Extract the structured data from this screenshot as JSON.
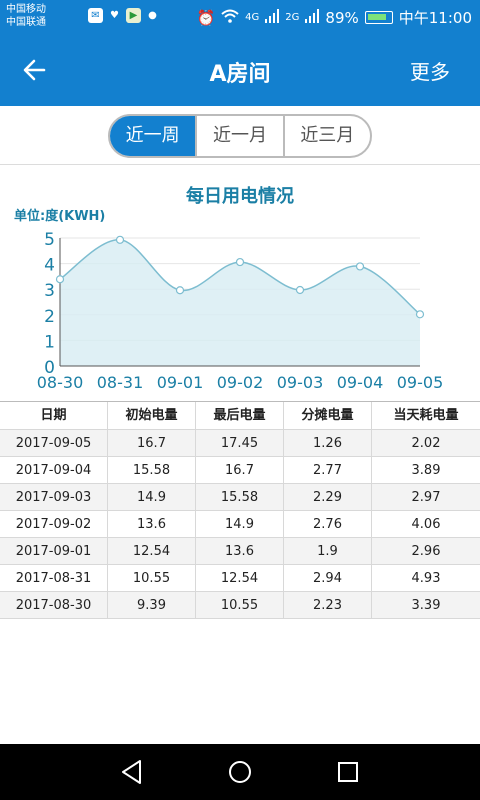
{
  "status_bar": {
    "carrier_1": "中国移动",
    "carrier_2": "中国联通",
    "net_4g": "4G",
    "net_2g": "2G",
    "battery": "89%",
    "time": "中午11:00"
  },
  "header": {
    "title": "A房间",
    "more_label": "更多"
  },
  "tabs": [
    {
      "label": "近一周",
      "active": true
    },
    {
      "label": "近一月",
      "active": false
    },
    {
      "label": "近三月",
      "active": false
    }
  ],
  "chart": {
    "title": "每日用电情况",
    "unit": "单位:度(KWH)"
  },
  "chart_data": {
    "type": "area",
    "title": "每日用电情况",
    "ylabel": "单位:度(KWH)",
    "x": [
      "08-30",
      "08-31",
      "09-01",
      "09-02",
      "09-03",
      "09-04",
      "09-05"
    ],
    "y_ticks": [
      "0",
      "1",
      "2",
      "3",
      "4",
      "5"
    ],
    "ylim": [
      0,
      5
    ],
    "values": [
      3.39,
      4.93,
      2.96,
      4.06,
      2.97,
      3.89,
      2.02
    ],
    "grid": true,
    "colors": {
      "line": "#7dbdd0",
      "fill": "#d7ecf3"
    }
  },
  "table": {
    "headers": [
      "日期",
      "初始电量",
      "最后电量",
      "分摊电量",
      "当天耗电量"
    ],
    "rows": [
      [
        "2017-09-05",
        "16.7",
        "17.45",
        "1.26",
        "2.02"
      ],
      [
        "2017-09-04",
        "15.58",
        "16.7",
        "2.77",
        "3.89"
      ],
      [
        "2017-09-03",
        "14.9",
        "15.58",
        "2.29",
        "2.97"
      ],
      [
        "2017-09-02",
        "13.6",
        "14.9",
        "2.76",
        "4.06"
      ],
      [
        "2017-09-01",
        "12.54",
        "13.6",
        "1.9",
        "2.96"
      ],
      [
        "2017-08-31",
        "10.55",
        "12.54",
        "2.94",
        "4.93"
      ],
      [
        "2017-08-30",
        "9.39",
        "10.55",
        "2.23",
        "3.39"
      ]
    ]
  },
  "colors": {
    "primary": "#1380cf",
    "chart_text": "#1b7fa5"
  }
}
